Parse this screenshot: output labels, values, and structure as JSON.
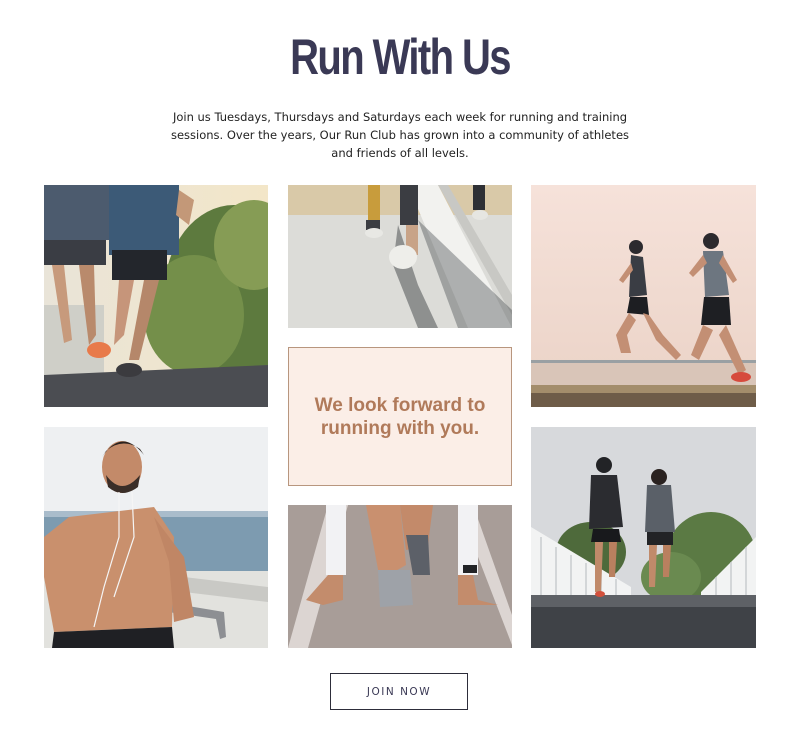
{
  "section": {
    "title": "Run With Us",
    "intro": "Join us Tuesdays, Thursdays and Saturdays each week for running and training sessions. Over the years, Our Run Club has grown into a community of athletes and friends of all levels."
  },
  "gallery": {
    "quote": "We look forward to running with you."
  },
  "cta": {
    "label": "JOIN NOW"
  },
  "colors": {
    "title": "#3a3955",
    "quote_text": "#b07a5a",
    "quote_background": "#fbeee7",
    "quote_border": "#b8967e"
  }
}
